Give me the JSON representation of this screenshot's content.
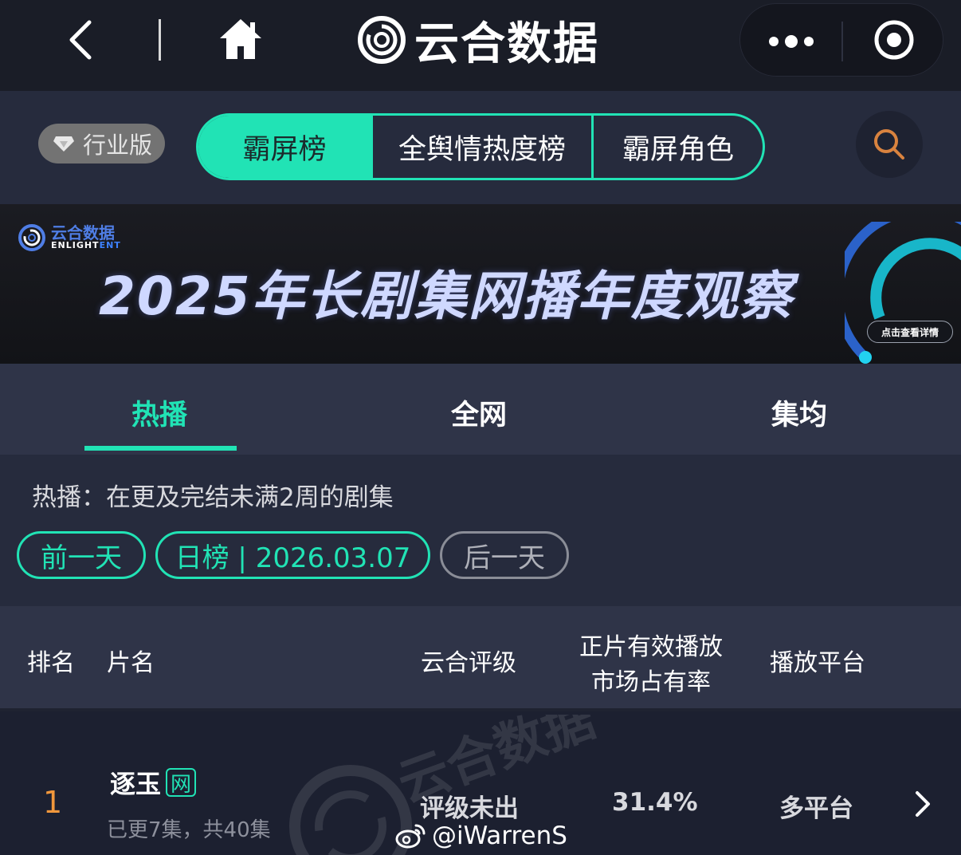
{
  "topbar": {
    "brand": "云合数据"
  },
  "header": {
    "industry_label": "行业版",
    "segments": [
      "霸屏榜",
      "全舆情热度榜",
      "霸屏角色"
    ],
    "active_segment": 0
  },
  "banner": {
    "logo_cn": "云合数据",
    "logo_en_a": "ENLIGHT",
    "logo_en_b": "ENT",
    "title": "2025年长剧集网播年度观察",
    "cta": "点击查看详情"
  },
  "tabs": [
    "热播",
    "全网",
    "集均"
  ],
  "filter": {
    "description": "热播：在更及完结未满2周的剧集",
    "prev_label": "前一天",
    "current_label": "日榜 | 2026.03.07",
    "next_label": "后一天"
  },
  "table": {
    "columns": {
      "rank": "排名",
      "name": "片名",
      "rating": "云合评级",
      "share_line1": "正片有效播放",
      "share_line2": "市场占有率",
      "platform": "播放平台"
    },
    "rows": [
      {
        "rank": "1",
        "title": "逐玉",
        "badge": "网",
        "episodes": "已更7集，共40集",
        "rating": "评级未出",
        "share": "31.4%",
        "platform": "多平台"
      }
    ]
  },
  "watermark": {
    "handle": "@iWarrenS"
  },
  "colors": {
    "accent": "#21e3b5",
    "rank": "#f0973c",
    "banner_title": "#cfd8ff"
  }
}
